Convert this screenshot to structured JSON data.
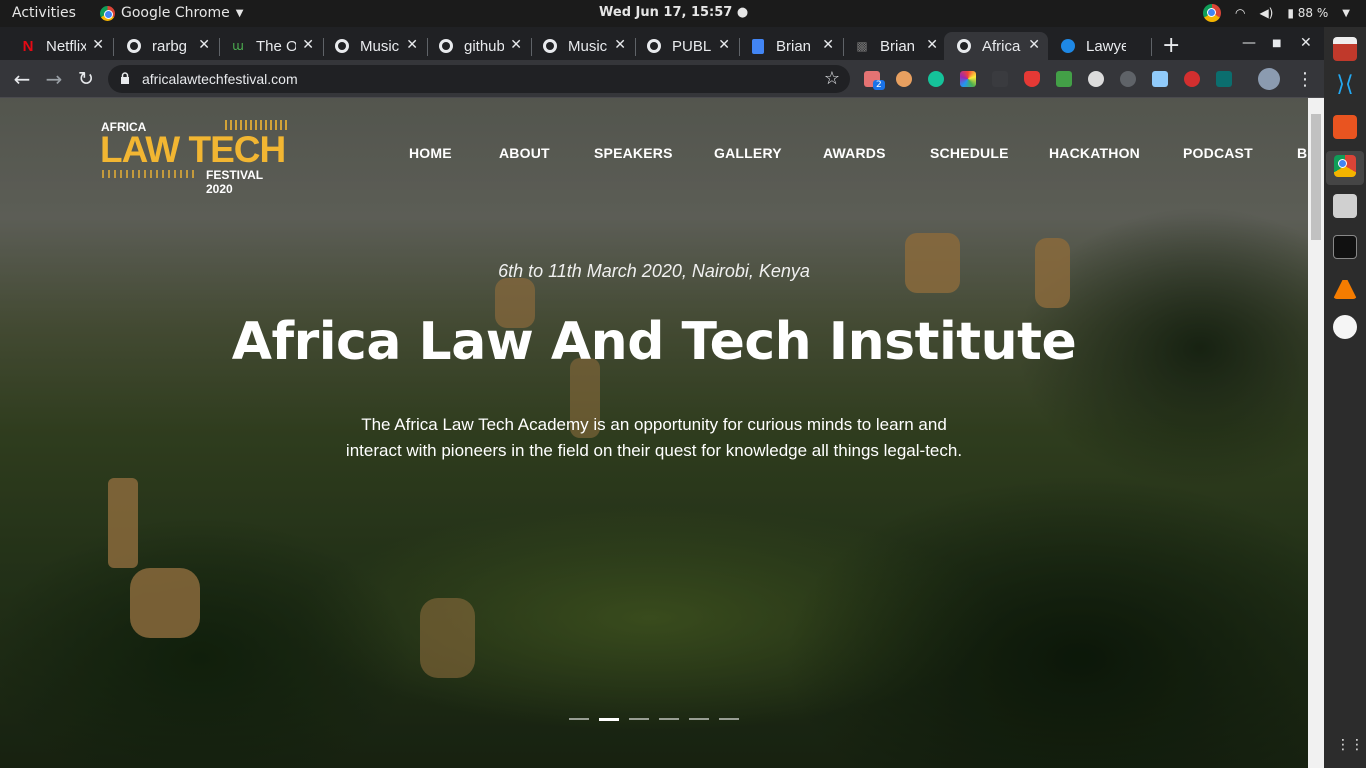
{
  "system": {
    "activities": "Activities",
    "app_name": "Google Chrome",
    "clock": "Wed Jun 17, 15:57",
    "battery": "88 %"
  },
  "tabs": [
    {
      "title": "Netflix",
      "icon": "netflix-icon"
    },
    {
      "title": "rarbg",
      "icon": "globe-icon"
    },
    {
      "title": "The O",
      "icon": "leaf-icon"
    },
    {
      "title": "Music",
      "icon": "globe-icon"
    },
    {
      "title": "github",
      "icon": "globe-icon"
    },
    {
      "title": "Music",
      "icon": "globe-icon"
    },
    {
      "title": "PUBLI",
      "icon": "globe-icon"
    },
    {
      "title": "Brian",
      "icon": "docs-icon"
    },
    {
      "title": "Brian",
      "icon": "dark-icon"
    },
    {
      "title": "Africa",
      "icon": "globe-icon",
      "active": true
    },
    {
      "title": "Lawye",
      "icon": "blue-site-icon"
    }
  ],
  "address_bar": {
    "url": "africalawtechfestival.com"
  },
  "site": {
    "logo": {
      "top": "AFRICA",
      "main": "LAW TECH",
      "bottom": "FESTIVAL 2020",
      "color": "#f2b632"
    },
    "nav": [
      "HOME",
      "ABOUT",
      "SPEAKERS",
      "GALLERY",
      "AWARDS",
      "SCHEDULE",
      "HACKATHON",
      "PODCAST",
      "BL"
    ],
    "hero": {
      "date": "6th to 11th March 2020, Nairobi, Kenya",
      "title": "Africa Law And Tech Institute",
      "text": "The Africa Law Tech Academy is an opportunity for curious minds to learn and interact with pioneers in the field on their quest for knowledge all things legal-tech.",
      "slides": 6,
      "active_slide": 2
    }
  },
  "extensions_badge": "2"
}
